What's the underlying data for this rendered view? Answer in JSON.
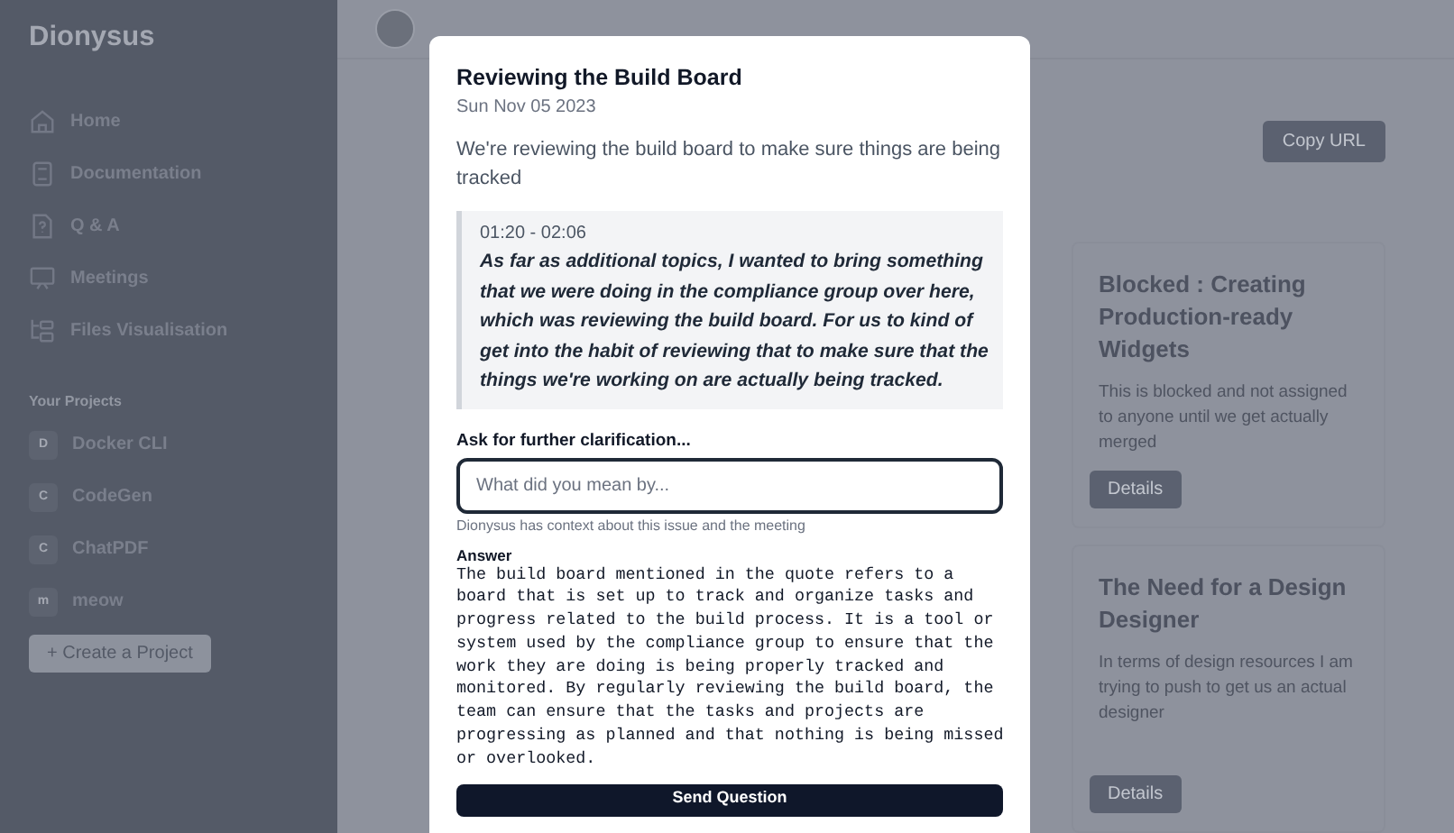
{
  "sidebar": {
    "brand": "Dionysus",
    "nav_items": [
      {
        "label": "Home",
        "kind": "home"
      },
      {
        "label": "Documentation",
        "kind": "docs"
      },
      {
        "label": "Q & A",
        "kind": "qa"
      },
      {
        "label": "Meetings",
        "kind": "meetings"
      },
      {
        "label": "Files Visualisation",
        "kind": "files"
      }
    ],
    "projects_heading": "Your Projects",
    "projects": [
      {
        "initial": "D",
        "name": "Docker CLI"
      },
      {
        "initial": "C",
        "name": "CodeGen"
      },
      {
        "initial": "C",
        "name": "ChatPDF"
      },
      {
        "initial": "m",
        "name": "meow"
      }
    ],
    "create_button": "+ Create a Project"
  },
  "main": {
    "copy_button": "Copy URL",
    "issues": [
      {
        "title": "Blocked : Creating Production-ready Widgets",
        "description": "This is blocked and not assigned to anyone until we get actually merged",
        "button": "Details"
      },
      {
        "title": "The Need for a Design Designer",
        "description": "In terms of design resources I am trying to push to get us an actual designer",
        "button": "Details"
      }
    ]
  },
  "dialog": {
    "title": "Reviewing the Build Board",
    "date": "Sun Nov 05 2023",
    "summary": "We're reviewing the build board to make sure things are being tracked",
    "quote": {
      "time": "01:20 - 02:06",
      "text": "As far as additional topics, I wanted to bring something that we were doing in the compliance group over here, which was reviewing the build board. For us to kind of get into the habit of reviewing that to make sure that the things we're working on are actually being tracked."
    },
    "question_label": "Ask for further clarification...",
    "question_field": {
      "placeholder": "What did you mean by..."
    },
    "hint": "Dionysus has context about this issue and the meeting",
    "answer_label": "Answer",
    "answer": "The build board mentioned in the quote refers to a board that is set up to track and organize tasks and progress related to the build process. It is a tool or system used by the compliance group to ensure that the work they are doing is being properly tracked and monitored. By regularly reviewing the build board, the team can ensure that the tasks and projects are progressing as planned and that nothing is being missed or overlooked.",
    "send_button": "Send Question"
  }
}
